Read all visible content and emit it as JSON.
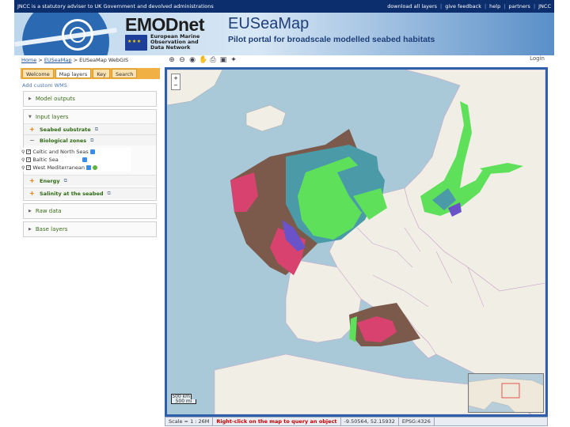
{
  "top_strip": {
    "left_text": "JNCC is a statutory adviser to UK Government and devolved administrations",
    "links": [
      "download all layers",
      "give feedback",
      "help",
      "partners",
      "JNCC"
    ]
  },
  "banner": {
    "brand": "EMODnet",
    "brand_sub": [
      "European Marine",
      "Observation and",
      "Data Network"
    ],
    "title": "EUSeaMap",
    "subtitle": "Pilot portal for broadscale modelled seabed habitats"
  },
  "breadcrumb": {
    "home": "Home",
    "sep": ">",
    "section": "EUSeaMap",
    "current": "EUSeaMap WebGIS",
    "login": "Login"
  },
  "tabs": [
    "Welcome",
    "Map layers",
    "Key",
    "Search"
  ],
  "add_wms": "Add custom WMS",
  "panels": {
    "model_outputs": "Model outputs",
    "input_layers": "Input layers",
    "seabed_substrate": "Seabed substrate",
    "biological_zones": "Biological zones",
    "layers": [
      "Celtic and North Seas",
      "Baltic Sea",
      "West Mediterranean"
    ],
    "energy": "Energy",
    "salinity": "Salinity at the seabed",
    "raw_data": "Raw data",
    "base_layers": "Base layers"
  },
  "map": {
    "scale_top": "500 km",
    "scale_bottom": "500 mi"
  },
  "status": {
    "scale": "Scale = 1 : 26M",
    "hint": "Right-click on the map to query an object",
    "coords": "-9.50564, 52.15932",
    "epsg": "EPSG:4326"
  },
  "colors": {
    "accent_blue": "#2f5eaa",
    "sea": "#a9c8d8",
    "land": "#f1eee6",
    "habitat_green": "#5fe05a",
    "habitat_teal": "#4a9aa8",
    "habitat_brown": "#7b5a4c",
    "habitat_pink": "#d8426e",
    "habitat_purple": "#6a52c8"
  }
}
